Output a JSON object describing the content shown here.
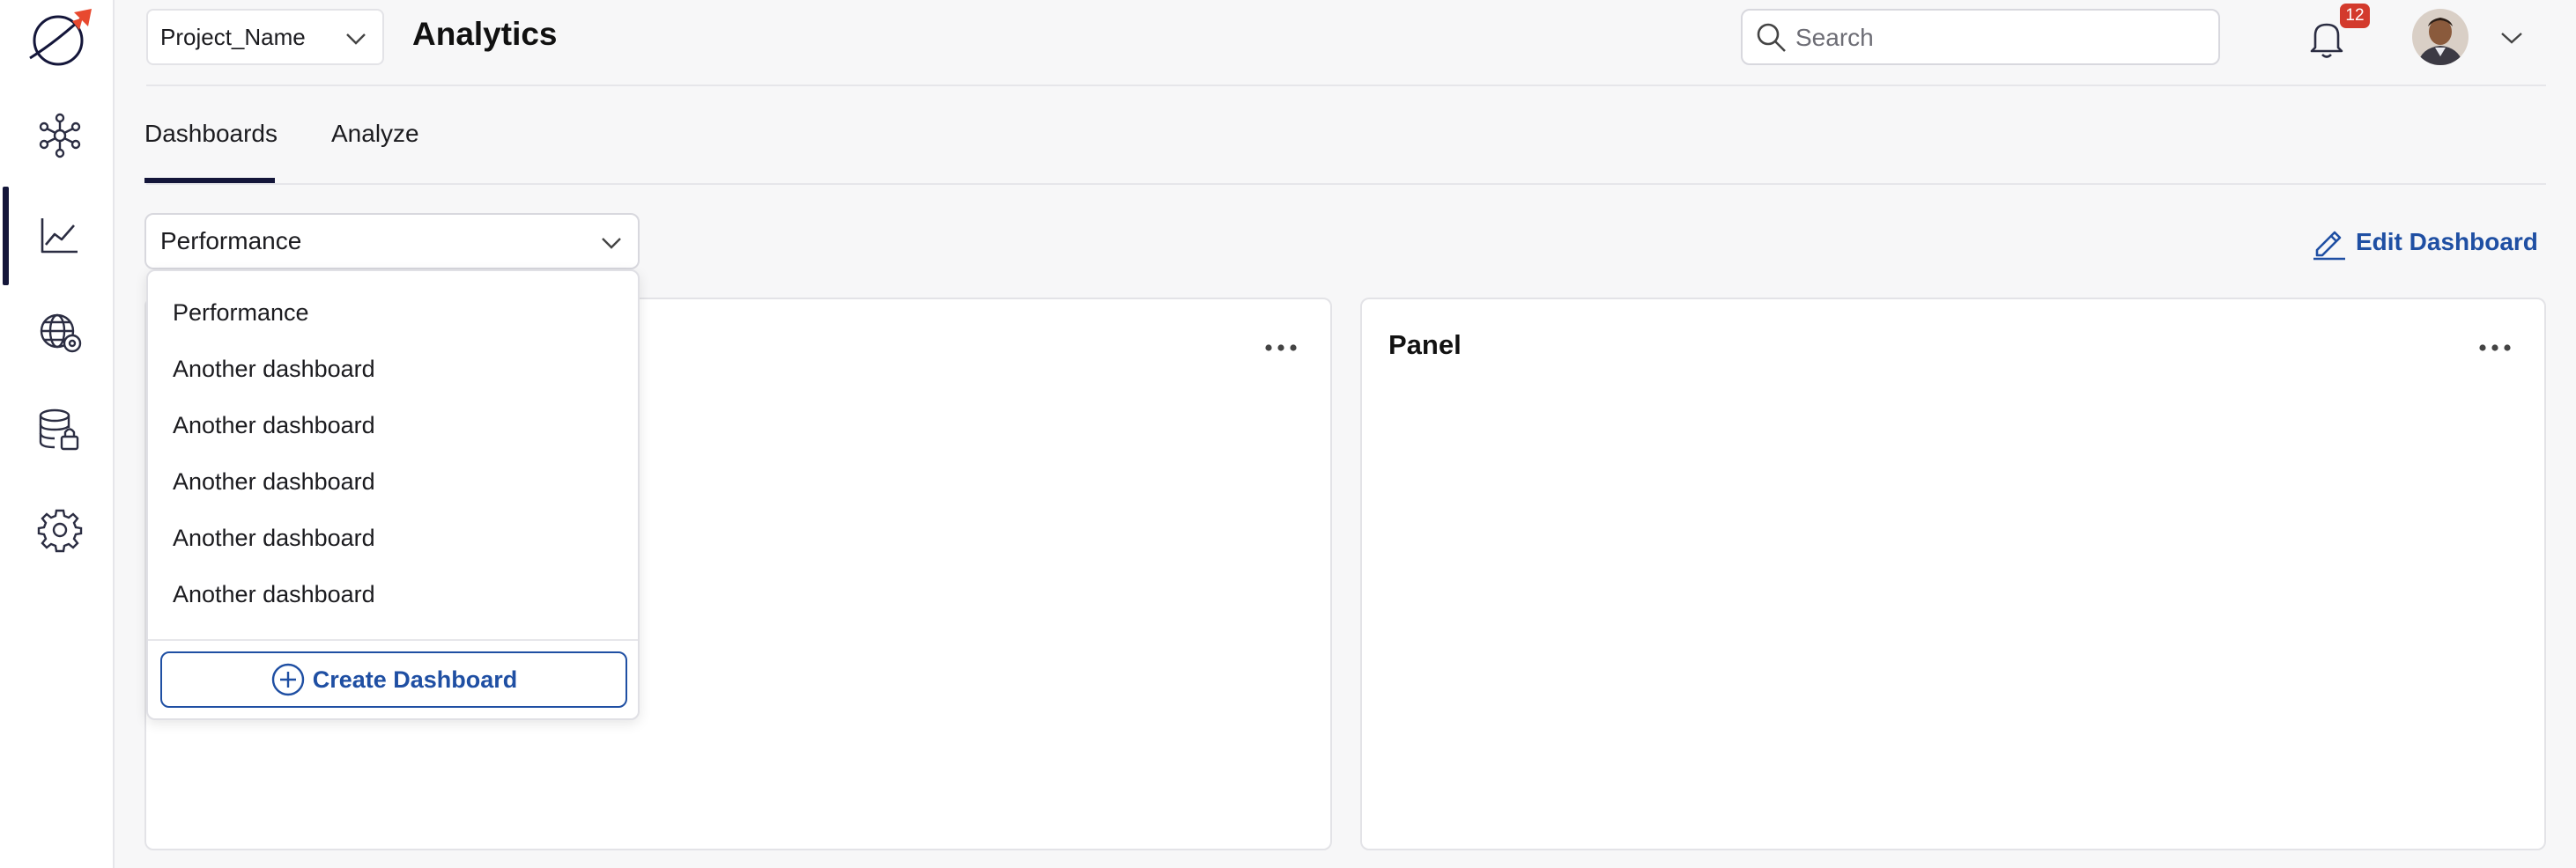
{
  "header": {
    "project_name": "Project_Name",
    "title": "Analytics",
    "search_placeholder": "Search",
    "notification_count": "12"
  },
  "sidebar": {
    "items": [
      {
        "icon": "network-icon"
      },
      {
        "icon": "line-chart-icon",
        "active": true
      },
      {
        "icon": "globe-settings-icon"
      },
      {
        "icon": "database-lock-icon"
      },
      {
        "icon": "gear-icon"
      }
    ]
  },
  "tabs": [
    {
      "label": "Dashboards",
      "active": true
    },
    {
      "label": "Analyze"
    }
  ],
  "dashboard_select": {
    "value": "Performance",
    "options": [
      "Performance",
      "Another dashboard",
      "Another dashboard",
      "Another dashboard",
      "Another dashboard",
      "Another dashboard"
    ],
    "create_label": "Create Dashboard"
  },
  "edit_dashboard_label": "Edit Dashboard",
  "panels": [
    {
      "title": ""
    },
    {
      "title": "Panel"
    }
  ],
  "colors": {
    "accent": "#1f4fa3",
    "sidebar_active": "#14163a",
    "badge": "#d33a2c",
    "logo_red": "#e8492f"
  }
}
